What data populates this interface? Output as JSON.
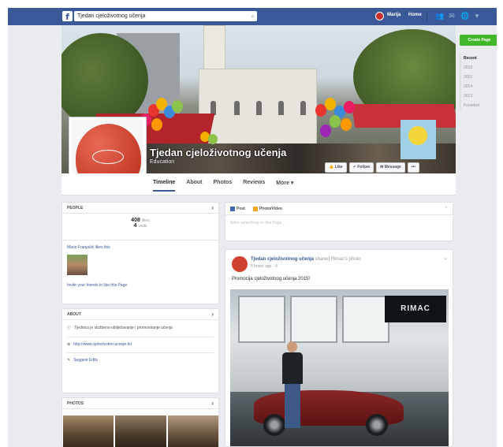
{
  "search": {
    "value": "Tjedan cjeloživotnog učenja"
  },
  "topbar": {
    "user_name": "Marija",
    "home_label": "Home"
  },
  "page": {
    "title": "Tjedan cjeloživotnog učenja",
    "category": "Education"
  },
  "cover_buttons": {
    "like": "Like",
    "follow": "Follow",
    "message": "Message",
    "more": "•••"
  },
  "nav_tabs": [
    "Timeline",
    "About",
    "Photos",
    "Reviews",
    "More ▾"
  ],
  "sidebar": {
    "create_page": "Create Page",
    "years": [
      "Recent",
      "2016",
      "2015",
      "2014",
      "2013",
      "Founded"
    ]
  },
  "people": {
    "header": "PEOPLE",
    "likes_count": "408",
    "likes_label": "likes",
    "visits_count": "4",
    "visits_label": "visits",
    "friends_text": "Mario Franjašić likes this",
    "invite_text": "Invite your friends to like this Page"
  },
  "about": {
    "header": "ABOUT",
    "description": "Tjednica je službeno obilježavanje i promoviranje učenja",
    "website": "http://www.cjelozivotno-ucenje.hr/",
    "suggest": "Suggest Edits"
  },
  "photos": {
    "header": "PHOTOS"
  },
  "composer": {
    "post_tab": "Post",
    "photo_tab": "Photo/Video",
    "placeholder": "Write something on this Page..."
  },
  "post": {
    "author": "Tjedan cjeloživotnog učenja",
    "action": "shared Rimac's photo",
    "time": "5 hours ago · ⚲",
    "text": "Promocija cjeloživotnog učenja 2015!",
    "image_brand": "RIMAC"
  }
}
